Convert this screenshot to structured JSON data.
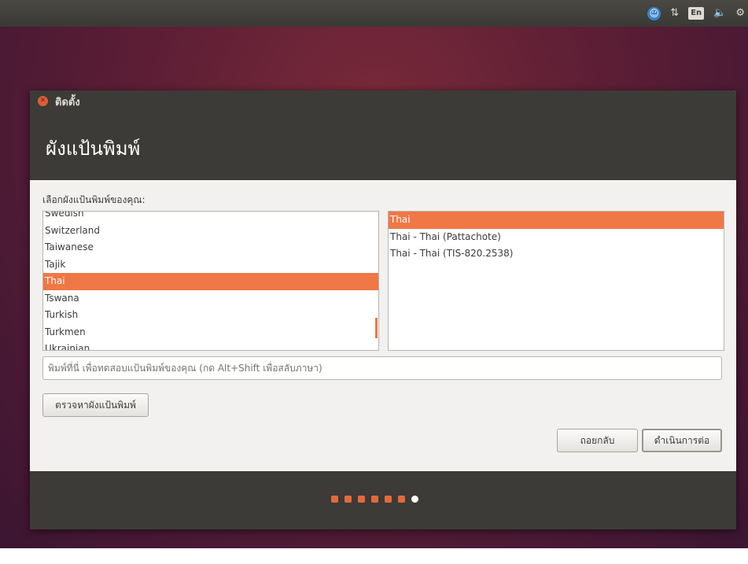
{
  "top_panel": {
    "accessibility_icon": "accessibility-icon",
    "network_icon": "network-arrows-icon",
    "keyboard_indicator": "En",
    "volume_icon": "volume-icon",
    "settings_icon": "gear-icon"
  },
  "window": {
    "title": "ติดตั้ง",
    "page_title": "ผังแป้นพิมพ์",
    "choose_label": "เลือกผังแป้นพิมพ์ของคุณ:",
    "layouts": [
      "Swedish",
      "Switzerland",
      "Taiwanese",
      "Tajik",
      "Thai",
      "Tswana",
      "Turkish",
      "Turkmen",
      "Ukrainian"
    ],
    "selected_layout": "Thai",
    "variants": [
      "Thai",
      "Thai - Thai (Pattachote)",
      "Thai - Thai (TIS-820.2538)"
    ],
    "selected_variant": "Thai",
    "test_input_placeholder": "พิมพ์ที่นี่ เพื่อทดสอบแป้นพิมพ์ของคุณ (กด Alt+Shift เพื่อสลับภาษา)",
    "test_input_value": "",
    "detect_button": "ตรวจหาผังแป้นพิมพ์",
    "back_button": "ถอยกลับ",
    "continue_button": "ดำเนินการต่อ"
  },
  "progress": {
    "total_steps": 7,
    "current_step": 7
  },
  "colors": {
    "accent": "#f07746",
    "panel": "#3c3b37",
    "window_bg": "#f2f1f0"
  }
}
